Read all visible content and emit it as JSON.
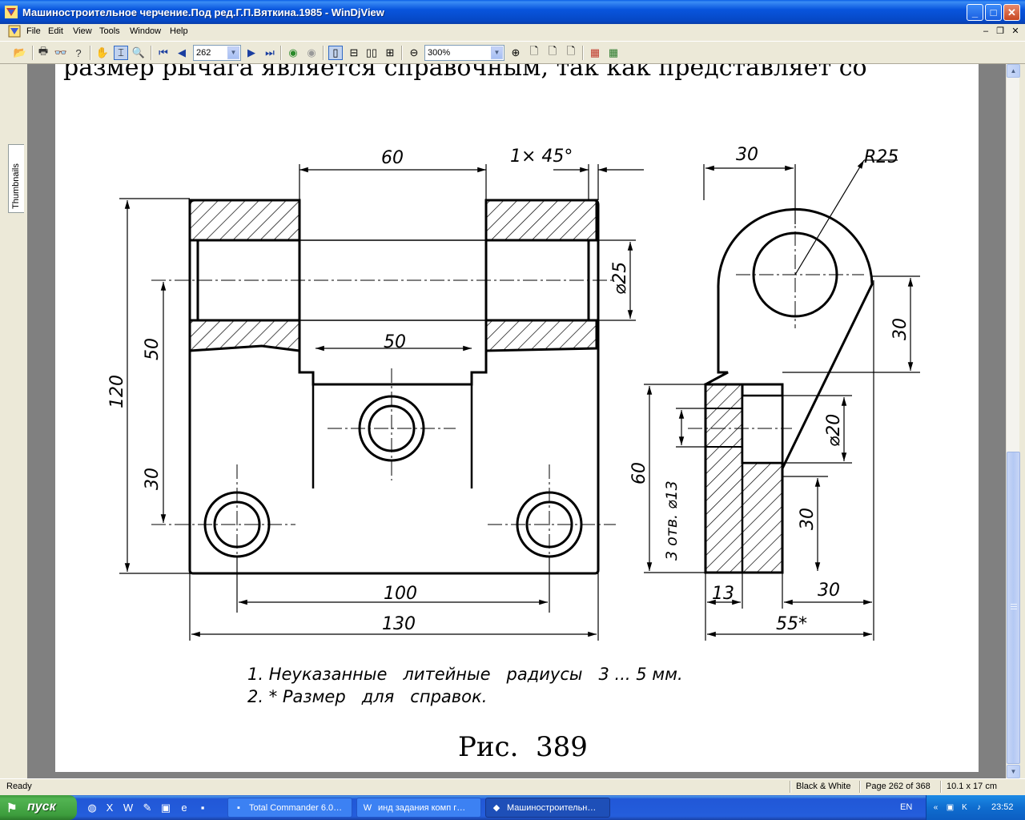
{
  "window": {
    "title": "Машиностроительное черчение.Под ред.Г.П.Вяткина.1985 - WinDjView",
    "controls": {
      "minimize": "_",
      "maximize": "□",
      "close": "✕"
    }
  },
  "menu": {
    "items": [
      "File",
      "Edit",
      "View",
      "Tools",
      "Window",
      "Help"
    ],
    "mdi": {
      "minimize": "–",
      "restore": "❐",
      "close": "✕"
    }
  },
  "toolbar": {
    "page_value": "262",
    "zoom_value": "300%"
  },
  "sidebar": {
    "tab_label": "Thumbnails"
  },
  "page": {
    "top_text": "размер рычага является справочным, так как представляет со",
    "dimensions": {
      "d60": "60",
      "chamfer": "1× 45°",
      "d30_top": "30",
      "r25": "R25",
      "d120": "120",
      "d50_left": "50",
      "d30_left": "30",
      "d50_mid": "50",
      "dia25": "⌀25",
      "d30_right": "30",
      "dia20": "⌀20",
      "d60_side": "60",
      "holes": "3 отв. ⌀13",
      "d30_side": "30",
      "d13": "13",
      "d30_bottom": "30",
      "d55": "55*",
      "d100": "100",
      "d130": "130"
    },
    "notes": [
      "1. Неуказанные   литейные   радиусы   3 ... 5 мм.",
      "2. * Размер   для   справок."
    ],
    "caption": "Рис.  389"
  },
  "status": {
    "left": "Ready",
    "mode": "Black & White",
    "page": "Page 262 of 368",
    "size": "10.1 x 17 cm"
  },
  "taskbar": {
    "start": "пуск",
    "tasks": [
      {
        "label": "Total Commander 6.0…",
        "icon": "floppy-icon"
      },
      {
        "label": "инд задания комп г…",
        "icon": "word-doc-icon"
      },
      {
        "label": "Машиностроительн…",
        "icon": "djview-icon"
      }
    ],
    "lang": "EN",
    "clock": "23:52"
  },
  "colors": {
    "titlebar": "#0a5fe6",
    "taskbar": "#245edc",
    "start": "#3d9d3d",
    "doc_background": "#808080"
  }
}
